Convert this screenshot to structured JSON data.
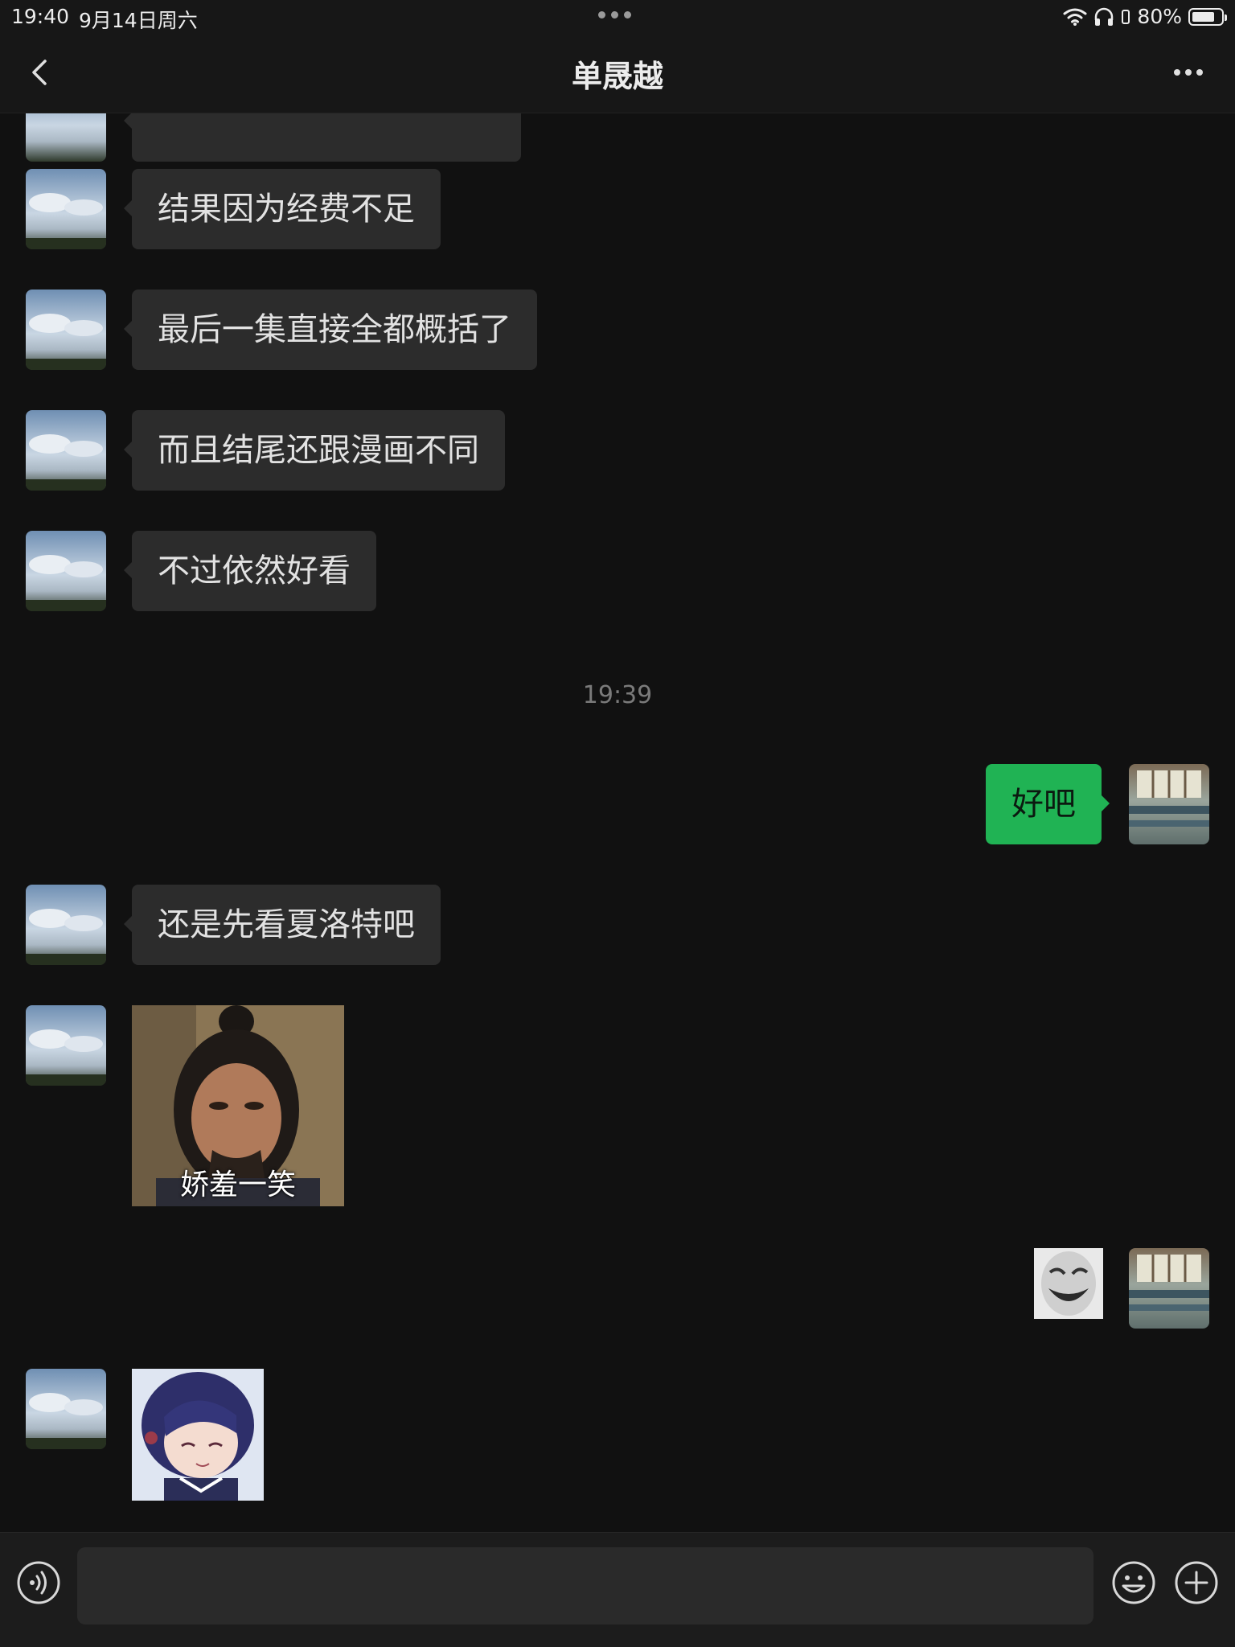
{
  "status_bar": {
    "time": "19:40",
    "date": "9月14日周六",
    "battery_text": "80%",
    "battery_level": 0.8
  },
  "nav": {
    "title": "单晟越",
    "back_icon": "chevron-left-icon",
    "more_icon": "ellipsis-icon"
  },
  "messages": [
    {
      "side": "left",
      "type": "text",
      "text": "结果因为经费不足"
    },
    {
      "side": "left",
      "type": "text",
      "text": "最后一集直接全都概括了"
    },
    {
      "side": "left",
      "type": "text",
      "text": "而且结尾还跟漫画不同"
    },
    {
      "side": "left",
      "type": "text",
      "text": "不过依然好看"
    },
    {
      "type": "time",
      "text": "19:39"
    },
    {
      "side": "right",
      "type": "text",
      "text": "好吧"
    },
    {
      "side": "left",
      "type": "text",
      "text": "还是先看夏洛特吧"
    },
    {
      "side": "left",
      "type": "sticker",
      "caption": "娇羞一笑"
    },
    {
      "side": "right",
      "type": "sticker"
    },
    {
      "side": "left",
      "type": "sticker"
    }
  ],
  "input_bar": {
    "voice_icon": "voice-icon",
    "emoji_icon": "emoji-icon",
    "plus_icon": "plus-icon",
    "field_value": ""
  },
  "colors": {
    "background": "#111111",
    "bubble_left": "#2c2c2c",
    "bubble_right": "#20b354",
    "timestamp": "#7a7a7a"
  }
}
